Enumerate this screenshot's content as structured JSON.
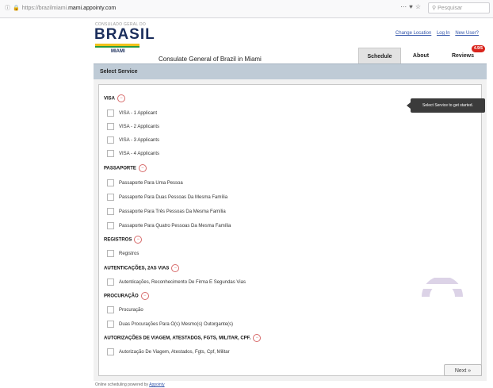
{
  "browser": {
    "url_prefix": "https://",
    "url_host": "mami.appointy.com",
    "url_faded": "brazilmiami.",
    "search_placeholder": "Pesquisar"
  },
  "header": {
    "logo_small": "CONSULADO GERAL DO",
    "logo_main": "BRASIL",
    "logo_city": "MIAMI",
    "title": "Consulate General of Brazil in Miami",
    "links": [
      "Change Location",
      "Log In",
      "New User?"
    ]
  },
  "tabs": [
    {
      "label": "Schedule",
      "active": true
    },
    {
      "label": "About",
      "active": false
    },
    {
      "label": "Reviews",
      "active": false,
      "badge": "4.9/5"
    }
  ],
  "select_service_label": "Select Service",
  "tooltip": "Select Service to get started.",
  "sections": [
    {
      "title": "VISA",
      "items": [
        "VISA - 1 Applicant",
        "VISA - 2 Applicants",
        "VISA - 3 Applicants",
        "VISA - 4 Applicants"
      ]
    },
    {
      "title": "PASSAPORTE",
      "items": [
        "Passaporte Para Uma Pessoa",
        "Passaporte Para Duas Pessoas Da Mesma Família",
        "Passaporte Para Três Pessoas Da Mesma Família",
        "Passaporte Para Quatro Pessoas Da Mesma Família"
      ]
    },
    {
      "title": "REGISTROS",
      "items": [
        "Registros"
      ]
    },
    {
      "title": "AUTENTICAÇÕES, 2AS VIAS",
      "items": [
        "Autenticações, Reconhecimento De Firma E Segundas Vias"
      ]
    },
    {
      "title": "PROCURAÇÃO",
      "items": [
        "Procuração",
        "Duas Procurações Para O(s) Mesmo(s) Outorgante(s)"
      ]
    },
    {
      "title": "AUTORIZAÇÕES DE VIAGEM, ATESTADOS, FGTS, MILITAR, CPF.",
      "items": [
        "Autorização De Viagem, Atestados, Fgts, Cpf, Militar"
      ]
    }
  ],
  "next_label": "Next »",
  "footer": {
    "text": "Online scheduling powered by",
    "link": "Appointy"
  },
  "colors": {
    "brand_navy": "#1b2e5c",
    "select_bar": "#bfcbd6",
    "toggle": "#d76a6a"
  }
}
